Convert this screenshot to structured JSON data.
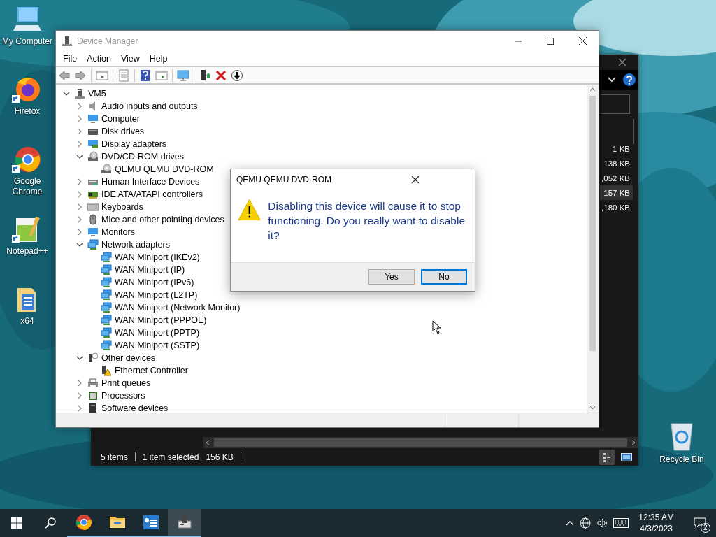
{
  "desktop_icons": [
    {
      "label": "My Computer",
      "kind": "computer",
      "shortcut": false
    },
    {
      "label": "Firefox",
      "kind": "firefox",
      "shortcut": true
    },
    {
      "label": "Google Chrome",
      "kind": "chrome",
      "shortcut": true
    },
    {
      "label": "Notepad++",
      "kind": "notepad",
      "shortcut": true
    },
    {
      "label": "x64",
      "kind": "folder",
      "shortcut": false
    }
  ],
  "recycle_bin": {
    "label": "Recycle Bin"
  },
  "explorer": {
    "sizes": [
      {
        "text": "1 KB",
        "selected": false
      },
      {
        "text": "138 KB",
        "selected": false
      },
      {
        "text": ",052 KB",
        "selected": false
      },
      {
        "text": "157 KB",
        "selected": true
      },
      {
        "text": ",180 KB",
        "selected": false
      }
    ],
    "status": [
      "5 items",
      "1 item selected",
      "156 KB"
    ]
  },
  "device_manager": {
    "title": "Device Manager",
    "menu": [
      "File",
      "Action",
      "View",
      "Help"
    ],
    "tree": {
      "label": "VM5",
      "kind": "pc",
      "expanded": true,
      "children": [
        {
          "label": "Audio inputs and outputs",
          "kind": "audio",
          "expanded": false
        },
        {
          "label": "Computer",
          "kind": "computer",
          "expanded": false
        },
        {
          "label": "Disk drives",
          "kind": "disk",
          "expanded": false
        },
        {
          "label": "Display adapters",
          "kind": "display",
          "expanded": false
        },
        {
          "label": "DVD/CD-ROM drives",
          "kind": "dvd",
          "expanded": true,
          "children": [
            {
              "label": "QEMU QEMU DVD-ROM",
              "kind": "dvd"
            }
          ]
        },
        {
          "label": "Human Interface Devices",
          "kind": "hid",
          "expanded": false
        },
        {
          "label": "IDE ATA/ATAPI controllers",
          "kind": "ide",
          "expanded": false
        },
        {
          "label": "Keyboards",
          "kind": "keyboard",
          "expanded": false
        },
        {
          "label": "Mice and other pointing devices",
          "kind": "mouse",
          "expanded": false
        },
        {
          "label": "Monitors",
          "kind": "monitor",
          "expanded": false
        },
        {
          "label": "Network adapters",
          "kind": "network",
          "expanded": true,
          "children": [
            {
              "label": "WAN Miniport (IKEv2)",
              "kind": "network"
            },
            {
              "label": "WAN Miniport (IP)",
              "kind": "network"
            },
            {
              "label": "WAN Miniport (IPv6)",
              "kind": "network"
            },
            {
              "label": "WAN Miniport (L2TP)",
              "kind": "network"
            },
            {
              "label": "WAN Miniport (Network Monitor)",
              "kind": "network"
            },
            {
              "label": "WAN Miniport (PPPOE)",
              "kind": "network"
            },
            {
              "label": "WAN Miniport (PPTP)",
              "kind": "network"
            },
            {
              "label": "WAN Miniport (SSTP)",
              "kind": "network"
            }
          ]
        },
        {
          "label": "Other devices",
          "kind": "other",
          "expanded": true,
          "children": [
            {
              "label": "Ethernet Controller",
              "kind": "warning"
            }
          ]
        },
        {
          "label": "Print queues",
          "kind": "printer",
          "expanded": false
        },
        {
          "label": "Processors",
          "kind": "processor",
          "expanded": false
        },
        {
          "label": "Software devices",
          "kind": "software",
          "expanded": false
        }
      ]
    }
  },
  "dialog": {
    "title": "QEMU QEMU DVD-ROM",
    "message": "Disabling this device will cause it to stop functioning. Do you really want to disable it?",
    "buttons": [
      {
        "label": "Yes",
        "selected": false
      },
      {
        "label": "No",
        "selected": true
      }
    ]
  },
  "taskbar": {
    "apps": [
      {
        "kind": "chrome",
        "selected": false
      },
      {
        "kind": "folder",
        "selected": false
      },
      {
        "kind": "settings",
        "selected": false
      },
      {
        "kind": "devmgr",
        "selected": true
      }
    ],
    "time": "12:35 AM",
    "date": "4/3/2023",
    "notifications": "2"
  }
}
